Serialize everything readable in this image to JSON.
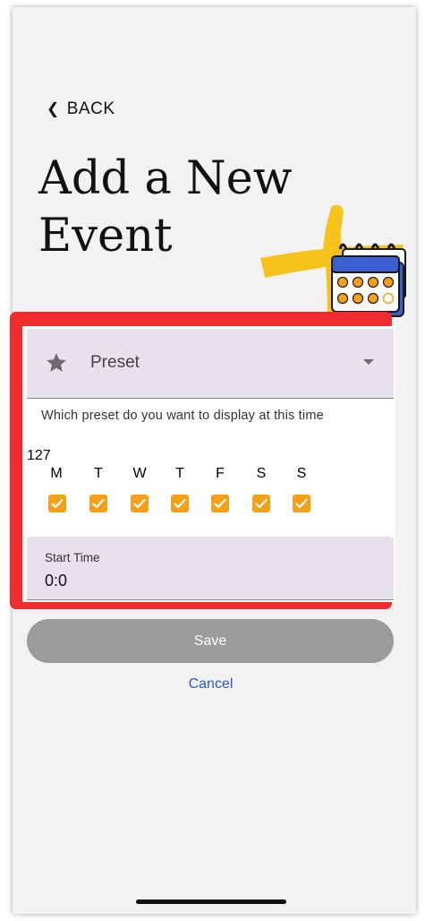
{
  "nav": {
    "back_label": "BACK"
  },
  "header": {
    "title_line1": "Add a New",
    "title_line2": "Event"
  },
  "form": {
    "preset": {
      "label": "Preset",
      "helper": "Which preset do you want to display at this time"
    },
    "days": {
      "count": "127",
      "labels": [
        "M",
        "T",
        "W",
        "T",
        "F",
        "S",
        "S"
      ],
      "checked": [
        true,
        true,
        true,
        true,
        true,
        true,
        true
      ]
    },
    "start_time": {
      "label": "Start Time",
      "value": "0:0"
    }
  },
  "actions": {
    "save_label": "Save",
    "cancel_label": "Cancel"
  },
  "colors": {
    "highlight": "#ef2b2b",
    "checkbox": "#f6a019",
    "link": "#2a57c9",
    "deco_yellow": "#f7c21a",
    "calendar_blue": "#3a5fd0"
  }
}
